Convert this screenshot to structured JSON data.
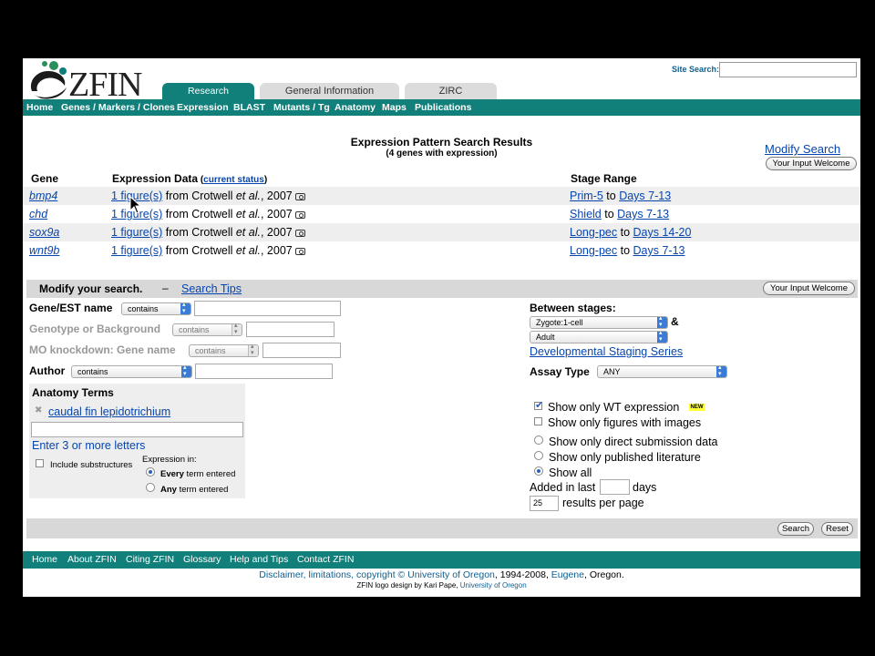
{
  "header": {
    "logo_text": "ZFIN",
    "site_search_label": "Site Search:",
    "site_search_value": ""
  },
  "tabs": [
    {
      "label": "Research",
      "active": true
    },
    {
      "label": "General Information",
      "active": false
    },
    {
      "label": "ZIRC",
      "active": false
    }
  ],
  "nav": [
    "Home",
    "Genes / Markers / Clones",
    "Expression",
    "BLAST",
    "Mutants / Tg",
    "Anatomy",
    "Maps",
    "Publications"
  ],
  "results": {
    "title": "Expression Pattern Search Results",
    "subtitle": "(4 genes with expression)",
    "modify_link": "Modify Search",
    "input_welcome": "Your Input Welcome",
    "col_gene": "Gene",
    "col_expr": "Expression Data",
    "col_expr_paren_open": " (",
    "col_expr_link": "current status",
    "col_expr_paren_close": ")",
    "col_stage": "Stage Range",
    "rows": [
      {
        "gene": "bmp4",
        "figs": "1 figure(s)",
        "from": " from Crotwell ",
        "etal": "et al.",
        "year": ", 2007",
        "stage_start": "Prim-5",
        "to": " to ",
        "stage_end": "Days 7-13"
      },
      {
        "gene": "chd",
        "figs": "1 figure(s)",
        "from": " from Crotwell ",
        "etal": "et al.",
        "year": ", 2007",
        "stage_start": "Shield",
        "to": " to ",
        "stage_end": "Days 7-13"
      },
      {
        "gene": "sox9a",
        "figs": "1 figure(s)",
        "from": " from Crotwell ",
        "etal": "et al.",
        "year": ", 2007",
        "stage_start": "Long-pec",
        "to": " to ",
        "stage_end": "Days 14-20"
      },
      {
        "gene": "wnt9b",
        "figs": "1 figure(s)",
        "from": " from Crotwell ",
        "etal": "et al.",
        "year": ", 2007",
        "stage_start": "Long-pec",
        "to": " to ",
        "stage_end": "Days 7-13"
      }
    ]
  },
  "modify": {
    "title": "Modify your search.",
    "dash": "–",
    "tips_link": "Search Tips",
    "input_welcome": "Your Input Welcome"
  },
  "form": {
    "gene_label": "Gene/EST name",
    "gene_op": "contains",
    "genotype_label": "Genotype or Background",
    "genotype_op": "contains",
    "mo_label": "MO knockdown: Gene name",
    "mo_op": "contains",
    "author_label": "Author",
    "author_op": "contains",
    "between_label": "Between stages:",
    "stage_from": "Zygote:1-cell",
    "amp": "&",
    "stage_to": "Adult",
    "staging_link": "Developmental Staging Series",
    "assay_label": "Assay Type",
    "assay_value": "ANY",
    "anatomy_title": "Anatomy Terms",
    "anatomy_term": "caudal fin lepidotrichium",
    "anatomy_input": "",
    "anatomy_hint": "Enter 3 or more letters",
    "include_substructures": "Include substructures",
    "expression_in": "Expression in:",
    "every_bold": "Every",
    "every_rest": " term entered",
    "any_bold": "Any",
    "any_rest": " term entered",
    "wt_only": "Show only WT expression",
    "new_badge": "NEW",
    "images_only": "Show only figures with images",
    "direct_only": "Show only direct submission data",
    "published_only": "Show only published literature",
    "show_all": "Show all",
    "added_prefix": "Added in last",
    "added_value": "",
    "added_suffix": "days",
    "per_page_value": "25",
    "per_page_suffix": "results per page",
    "search_button": "Search",
    "reset_button": "Reset"
  },
  "footer": {
    "links": [
      "Home",
      "About ZFIN",
      "Citing ZFIN",
      "Glossary",
      "Help and Tips",
      "Contact ZFIN"
    ],
    "line1_a": "Disclaimer, limitations, copyright © University of Oregon",
    "line1_b": ", 1994-2008, ",
    "line1_c": "Eugene",
    "line1_d": ", Oregon.",
    "line2_a": "ZFIN logo design by Kari Pape, ",
    "line2_b": "University of Oregon"
  },
  "colors": {
    "brand_teal": "#117f7a",
    "link": "#0645ad",
    "panel_gray": "#d8d8d8"
  }
}
